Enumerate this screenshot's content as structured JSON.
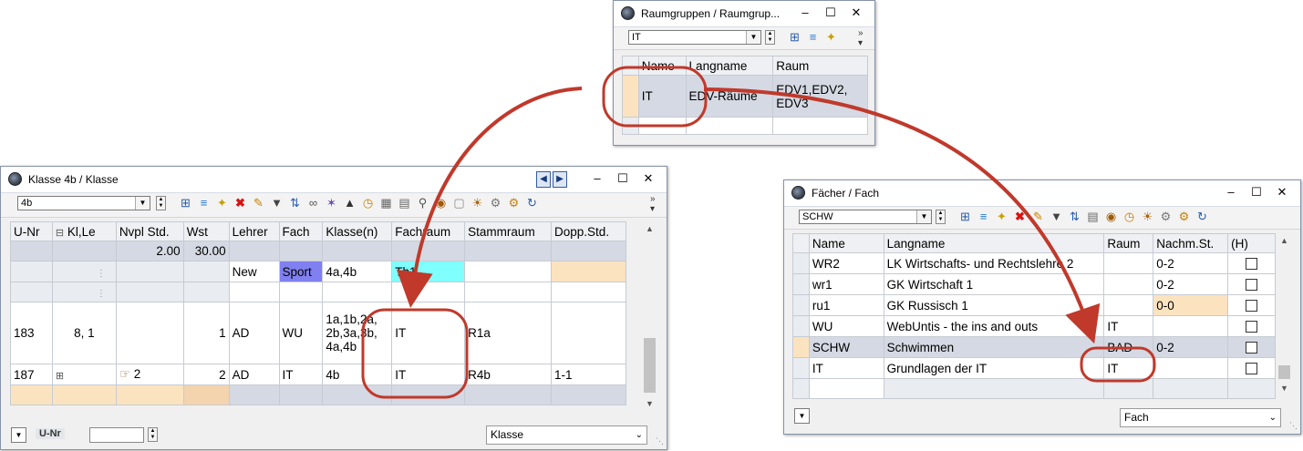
{
  "raumgruppen": {
    "title": "Raumgruppen / Raumgrup...",
    "combo_value": "IT",
    "headers": [
      "Name",
      "Langname",
      "Raum"
    ],
    "row": {
      "name": "IT",
      "langname": "EDV-Räume",
      "raum_line1": "EDV1,EDV2,",
      "raum_line2": "EDV3"
    }
  },
  "klasse": {
    "title": "Klasse 4b / Klasse",
    "combo_value": "4b",
    "headers": [
      "U-Nr",
      "Kl,Le",
      "Nvpl Std.",
      "Wst",
      "Lehrer",
      "Fach",
      "Klasse(n)",
      "Fachraum",
      "Stammraum",
      "Dopp.Std."
    ],
    "kl_expand": "⊟",
    "sum_row": {
      "nvpl": "2.00",
      "wst": "30.00"
    },
    "new_row": {
      "lehrer": "New",
      "fach": "Sport",
      "klassen": "4a,4b",
      "fachraum": "Th1"
    },
    "row183": {
      "unr": "183",
      "klle": "8, 1",
      "wst": "1",
      "lehrer": "AD",
      "fach": "WU",
      "klassen_l1": "1a,1b,2a,",
      "klassen_l2": "2b,3a,3b,",
      "klassen_l3": "4a,4b",
      "fachraum": "IT",
      "stammraum": "R1a"
    },
    "row187": {
      "unr": "187",
      "nvpl": "2",
      "wst": "2",
      "lehrer": "AD",
      "fach": "IT",
      "klassen": "4b",
      "fachraum": "IT",
      "stammraum": "R4b",
      "dopp": "1-1"
    },
    "footer_label": "U-Nr",
    "footer_select": "Klasse"
  },
  "faecher": {
    "title": "Fächer / Fach",
    "combo_value": "SCHW",
    "headers": [
      "Name",
      "Langname",
      "Raum",
      "Nachm.St.",
      "(H)"
    ],
    "rows": [
      {
        "name": "WR2",
        "langname": "LK Wirtschafts- und Rechtslehre 2",
        "raum": "",
        "nachm": "0-2"
      },
      {
        "name": "wr1",
        "langname": "GK Wirtschaft 1",
        "raum": "",
        "nachm": "0-2"
      },
      {
        "name": "ru1",
        "langname": "GK Russisch 1",
        "raum": "",
        "nachm": "0-0"
      },
      {
        "name": "WU",
        "langname": "WebUntis - the ins and outs",
        "raum": "IT",
        "nachm": ""
      },
      {
        "name": "SCHW",
        "langname": "Schwimmen",
        "raum": "BAD",
        "nachm": "0-2"
      },
      {
        "name": "IT",
        "langname": "Grundlagen der IT",
        "raum": "IT",
        "nachm": ""
      }
    ],
    "footer_select": "Fach"
  },
  "colors": {
    "annotation": "#c0392b",
    "sport_bg": "#8080f0",
    "th1_bg": "#80ffff",
    "highlight": "#fbe3c0",
    "selected_row": "#d4d9e3"
  },
  "icons": [
    "app-clock-icon",
    "add-row-icon",
    "list-icon",
    "new-icon",
    "delete-icon",
    "filter-icon",
    "sort-icon",
    "link-icon",
    "clock-icon",
    "settings-icon",
    "gear-icon",
    "refresh-icon"
  ]
}
